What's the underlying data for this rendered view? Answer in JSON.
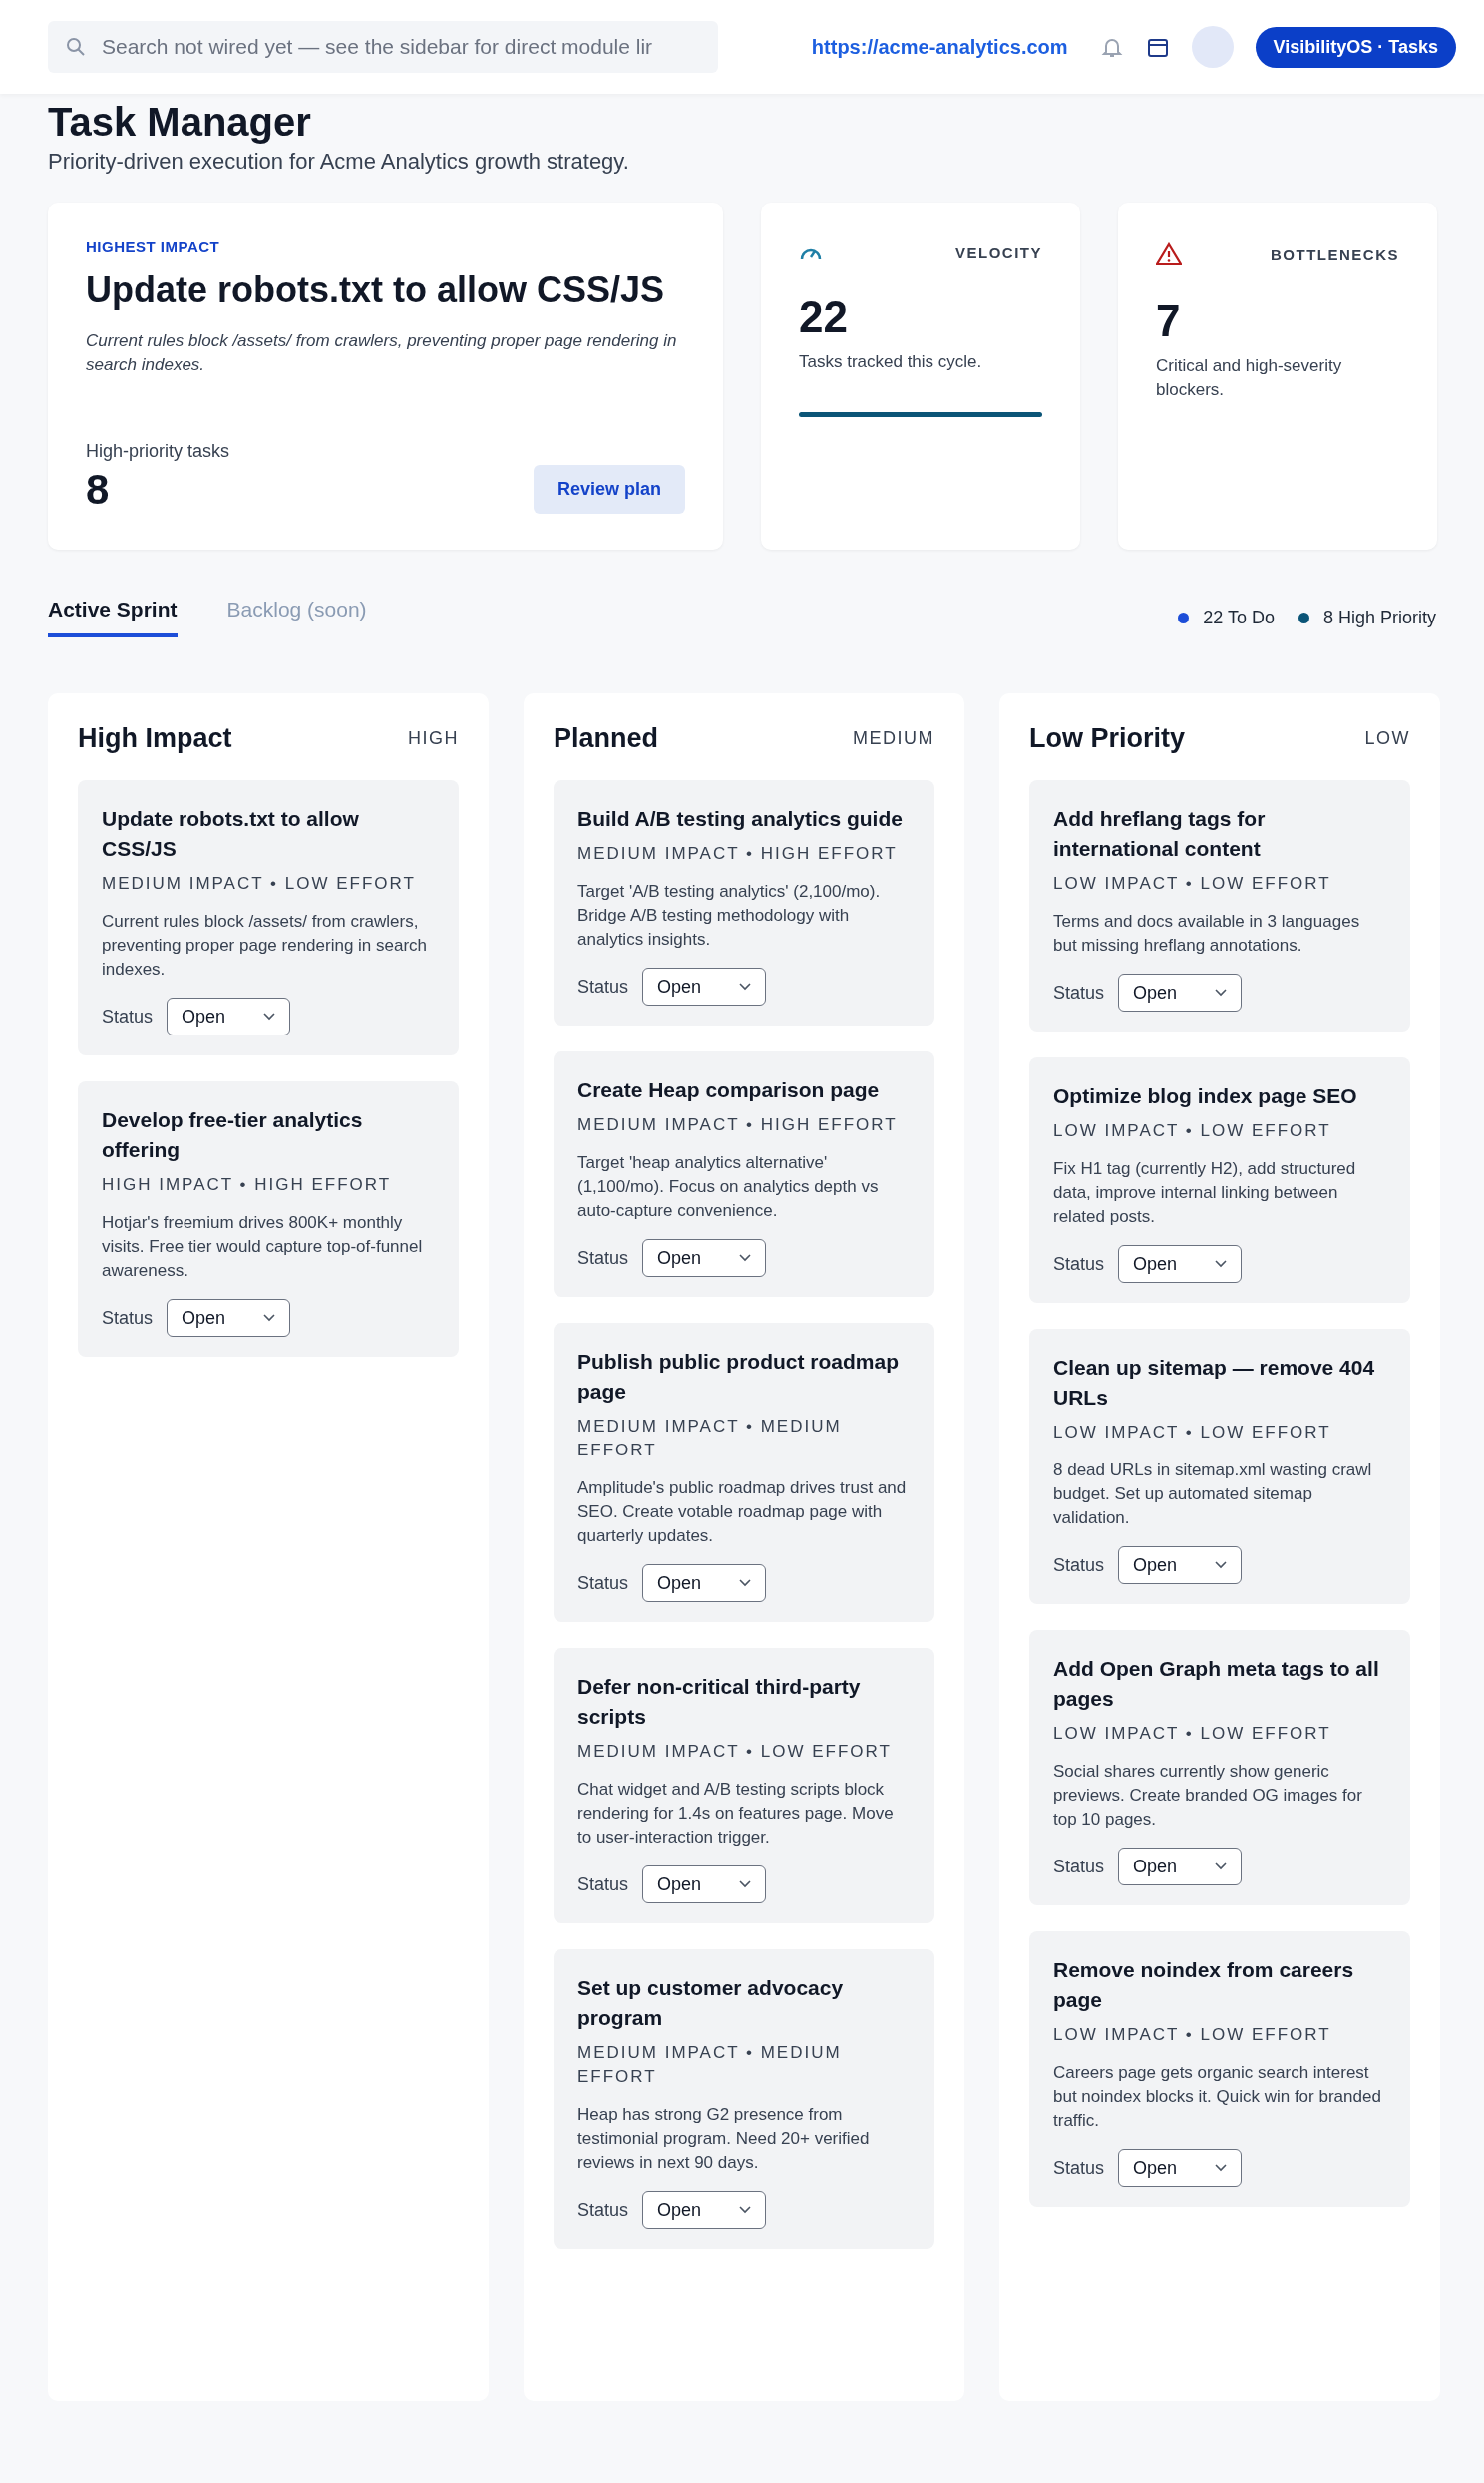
{
  "header": {
    "search": {
      "placeholder": "Search not wired yet — see the sidebar for direct module lir"
    },
    "site_link": "https://acme-analytics.com",
    "badge": "VisibilityOS · Tasks"
  },
  "page": {
    "title": "Task Manager",
    "subtitle": "Priority-driven execution for Acme Analytics growth strategy."
  },
  "highlight": {
    "eyebrow": "HIGHEST IMPACT",
    "title": "Update robots.txt to allow CSS/JS",
    "description": "Current rules block /assets/ from crawlers, preventing proper page rendering in search indexes.",
    "count_label": "High-priority tasks",
    "count": "8",
    "button": "Review plan"
  },
  "stats": [
    {
      "kind": "velocity",
      "label": "VELOCITY",
      "value": "22",
      "caption": "Tasks tracked this cycle."
    },
    {
      "kind": "bottlenecks",
      "label": "BOTTLENECKS",
      "value": "7",
      "caption": "Critical and high-severity blockers."
    }
  ],
  "tabs": [
    {
      "label": "Active Sprint",
      "selected": true,
      "disabled": false
    },
    {
      "label": "Backlog (soon)",
      "selected": false,
      "disabled": true
    }
  ],
  "legend": [
    {
      "label": "22 To Do",
      "color": "#1d4ed8"
    },
    {
      "label": "8 High Priority",
      "color": "#0b5577"
    }
  ],
  "columns": [
    {
      "title": "High Impact",
      "priority": "HIGH",
      "tasks": [
        {
          "title": "Update robots.txt to allow CSS/JS",
          "meta": "MEDIUM IMPACT • LOW EFFORT",
          "description": "Current rules block /assets/ from crawlers, preventing proper page rendering in search indexes.",
          "status_label": "Status",
          "status": "Open"
        },
        {
          "title": "Develop free-tier analytics offering",
          "meta": "HIGH IMPACT • HIGH EFFORT",
          "description": "Hotjar's freemium drives 800K+ monthly visits. Free tier would capture top-of-funnel awareness.",
          "status_label": "Status",
          "status": "Open"
        }
      ]
    },
    {
      "title": "Planned",
      "priority": "MEDIUM",
      "tasks": [
        {
          "title": "Build A/B testing analytics guide",
          "meta": "MEDIUM IMPACT • HIGH EFFORT",
          "description": "Target 'A/B testing analytics' (2,100/mo). Bridge A/B testing methodology with analytics insights.",
          "status_label": "Status",
          "status": "Open"
        },
        {
          "title": "Create Heap comparison page",
          "meta": "MEDIUM IMPACT • HIGH EFFORT",
          "description": "Target 'heap analytics alternative' (1,100/mo). Focus on analytics depth vs auto-capture convenience.",
          "status_label": "Status",
          "status": "Open"
        },
        {
          "title": "Publish public product roadmap page",
          "meta": "MEDIUM IMPACT • MEDIUM EFFORT",
          "description": "Amplitude's public roadmap drives trust and SEO. Create votable roadmap page with quarterly updates.",
          "status_label": "Status",
          "status": "Open"
        },
        {
          "title": "Defer non-critical third-party scripts",
          "meta": "MEDIUM IMPACT • LOW EFFORT",
          "description": "Chat widget and A/B testing scripts block rendering for 1.4s on features page. Move to user-interaction trigger.",
          "status_label": "Status",
          "status": "Open"
        },
        {
          "title": "Set up customer advocacy program",
          "meta": "MEDIUM IMPACT • MEDIUM EFFORT",
          "description": "Heap has strong G2 presence from testimonial program. Need 20+ verified reviews in next 90 days.",
          "status_label": "Status",
          "status": "Open"
        }
      ]
    },
    {
      "title": "Low Priority",
      "priority": "LOW",
      "tasks": [
        {
          "title": "Add hreflang tags for international content",
          "meta": "LOW IMPACT • LOW EFFORT",
          "description": "Terms and docs available in 3 languages but missing hreflang annotations.",
          "status_label": "Status",
          "status": "Open"
        },
        {
          "title": "Optimize blog index page SEO",
          "meta": "LOW IMPACT • LOW EFFORT",
          "description": "Fix H1 tag (currently H2), add structured data, improve internal linking between related posts.",
          "status_label": "Status",
          "status": "Open"
        },
        {
          "title": "Clean up sitemap — remove 404 URLs",
          "meta": "LOW IMPACT • LOW EFFORT",
          "description": "8 dead URLs in sitemap.xml wasting crawl budget. Set up automated sitemap validation.",
          "status_label": "Status",
          "status": "Open"
        },
        {
          "title": "Add Open Graph meta tags to all pages",
          "meta": "LOW IMPACT • LOW EFFORT",
          "description": "Social shares currently show generic previews. Create branded OG images for top 10 pages.",
          "status_label": "Status",
          "status": "Open"
        },
        {
          "title": "Remove noindex from careers page",
          "meta": "LOW IMPACT • LOW EFFORT",
          "description": "Careers page gets organic search interest but noindex blocks it. Quick win for branded traffic.",
          "status_label": "Status",
          "status": "Open"
        }
      ]
    }
  ]
}
